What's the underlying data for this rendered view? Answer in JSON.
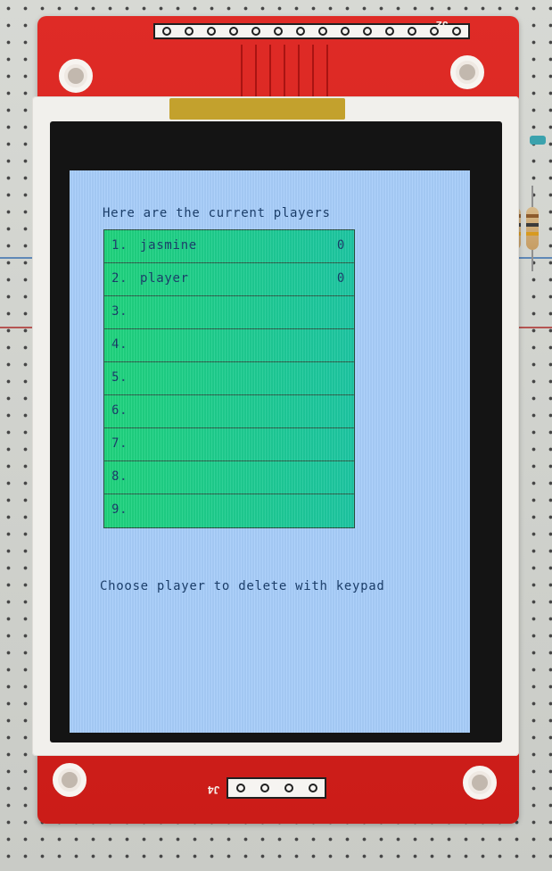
{
  "screen": {
    "title": "Here are the current players",
    "instruction": "Choose player to delete with keypad"
  },
  "board_labels": {
    "top_header": "J2",
    "bottom_header": "J4"
  },
  "players": [
    {
      "index": "1.",
      "name": "jasmine",
      "score": "0"
    },
    {
      "index": "2.",
      "name": "player",
      "score": "0"
    },
    {
      "index": "3.",
      "name": "",
      "score": ""
    },
    {
      "index": "4.",
      "name": "",
      "score": ""
    },
    {
      "index": "5.",
      "name": "",
      "score": ""
    },
    {
      "index": "6.",
      "name": "",
      "score": ""
    },
    {
      "index": "7.",
      "name": "",
      "score": ""
    },
    {
      "index": "8.",
      "name": "",
      "score": ""
    },
    {
      "index": "9.",
      "name": "",
      "score": ""
    }
  ],
  "colors": {
    "screen_background": "#a7cdfa",
    "row_green": "#1fd37c",
    "row_teal": "#1dc6a2",
    "text_blue": "#173b68",
    "pcb_red": "#cb1c18"
  }
}
